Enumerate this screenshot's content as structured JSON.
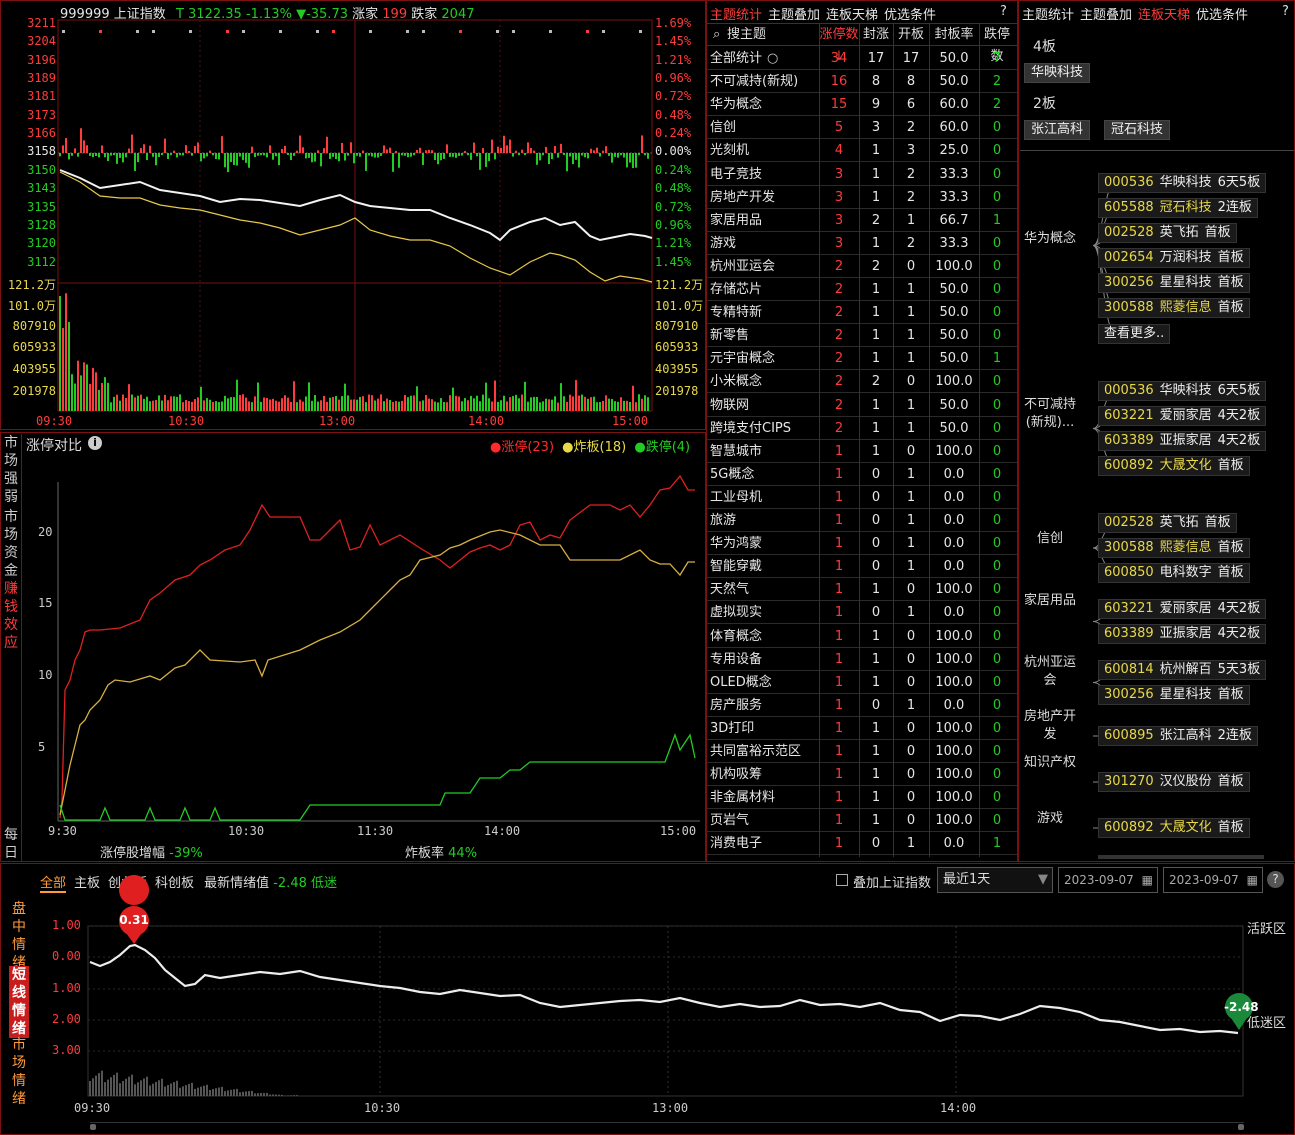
{
  "index_chart": {
    "code": "999999",
    "name": "上证指数",
    "t_label": "T",
    "price": "3122.35",
    "pct": "-1.13%",
    "change": "▼-35.73",
    "rise_label": "涨家",
    "rise_count": "199",
    "fall_label": "跌家",
    "fall_count": "2047",
    "price_ticks": [
      "3211",
      "3204",
      "3196",
      "3189",
      "3181",
      "3173",
      "3166",
      "3158",
      "3150",
      "3143",
      "3135",
      "3128",
      "3120",
      "3112"
    ],
    "pct_ticks": [
      "1.69%",
      "1.45%",
      "1.21%",
      "0.96%",
      "0.72%",
      "0.48%",
      "0.24%",
      "0.00%",
      "0.24%",
      "0.48%",
      "0.72%",
      "0.96%",
      "1.21%",
      "1.45%"
    ],
    "vol_ticks_left": [
      "121.2万",
      "101.0万",
      "807910",
      "605933",
      "403955",
      "201978"
    ],
    "vol_ticks_right": [
      "121.2万",
      "101.0万",
      "807910",
      "605933",
      "403955",
      "201978"
    ],
    "time_ticks": [
      "09:30",
      "10:30",
      "13:00",
      "14:00",
      "15:00"
    ]
  },
  "limit_compare": {
    "side_tabs": [
      "市场强弱",
      "市场资金",
      "赚钱效应",
      "每日"
    ],
    "title": "涨停对比",
    "info_icon": "info-icon",
    "legend": [
      {
        "label": "涨停(23)",
        "color": "#ff2a2a"
      },
      {
        "label": "炸板(18)",
        "color": "#e8d84a"
      },
      {
        "label": "跌停(4)",
        "color": "#22cc22"
      }
    ],
    "y_ticks": [
      "20",
      "15",
      "10",
      "5"
    ],
    "x_ticks": [
      "9:30",
      "10:30",
      "11:30",
      "14:00",
      "15:00"
    ],
    "footer_left_label": "涨停股增幅",
    "footer_left_value": "-39%",
    "footer_right_label": "炸板率",
    "footer_right_value": "44%"
  },
  "theme_stats": {
    "tabs": [
      "主题统计",
      "主题叠加",
      "连板天梯",
      "优选条件"
    ],
    "active_tab": 0,
    "help": "?",
    "headers": [
      "搜主题",
      "涨停数↓",
      "封涨",
      "开板",
      "封板率",
      "跌停数"
    ],
    "search_icon": "search-icon",
    "rows": [
      [
        "全部统计",
        "34",
        "17",
        "17",
        "50.0",
        "7"
      ],
      [
        "不可减持(新规)",
        "16",
        "8",
        "8",
        "50.0",
        "2"
      ],
      [
        "华为概念",
        "15",
        "9",
        "6",
        "60.0",
        "2"
      ],
      [
        "信创",
        "5",
        "3",
        "2",
        "60.0",
        "0"
      ],
      [
        "光刻机",
        "4",
        "1",
        "3",
        "25.0",
        "0"
      ],
      [
        "电子竞技",
        "3",
        "1",
        "2",
        "33.3",
        "0"
      ],
      [
        "房地产开发",
        "3",
        "1",
        "2",
        "33.3",
        "0"
      ],
      [
        "家居用品",
        "3",
        "2",
        "1",
        "66.7",
        "1"
      ],
      [
        "游戏",
        "3",
        "1",
        "2",
        "33.3",
        "0"
      ],
      [
        "杭州亚运会",
        "2",
        "2",
        "0",
        "100.0",
        "0"
      ],
      [
        "存储芯片",
        "2",
        "1",
        "1",
        "50.0",
        "0"
      ],
      [
        "专精特新",
        "2",
        "1",
        "1",
        "50.0",
        "0"
      ],
      [
        "新零售",
        "2",
        "1",
        "1",
        "50.0",
        "0"
      ],
      [
        "元宇宙概念",
        "2",
        "1",
        "1",
        "50.0",
        "1"
      ],
      [
        "小米概念",
        "2",
        "2",
        "0",
        "100.0",
        "0"
      ],
      [
        "物联网",
        "2",
        "1",
        "1",
        "50.0",
        "0"
      ],
      [
        "跨境支付CIPS",
        "2",
        "1",
        "1",
        "50.0",
        "0"
      ],
      [
        "智慧城市",
        "1",
        "1",
        "0",
        "100.0",
        "0"
      ],
      [
        "5G概念",
        "1",
        "0",
        "1",
        "0.0",
        "0"
      ],
      [
        "工业母机",
        "1",
        "0",
        "1",
        "0.0",
        "0"
      ],
      [
        "旅游",
        "1",
        "0",
        "1",
        "0.0",
        "0"
      ],
      [
        "华为鸿蒙",
        "1",
        "0",
        "1",
        "0.0",
        "0"
      ],
      [
        "智能穿戴",
        "1",
        "0",
        "1",
        "0.0",
        "0"
      ],
      [
        "天然气",
        "1",
        "1",
        "0",
        "100.0",
        "0"
      ],
      [
        "虚拟现实",
        "1",
        "0",
        "1",
        "0.0",
        "0"
      ],
      [
        "体育概念",
        "1",
        "1",
        "0",
        "100.0",
        "0"
      ],
      [
        "专用设备",
        "1",
        "1",
        "0",
        "100.0",
        "0"
      ],
      [
        "OLED概念",
        "1",
        "1",
        "0",
        "100.0",
        "0"
      ],
      [
        "房产服务",
        "1",
        "0",
        "1",
        "0.0",
        "0"
      ],
      [
        "3D打印",
        "1",
        "1",
        "0",
        "100.0",
        "0"
      ],
      [
        "共同富裕示范区",
        "1",
        "1",
        "0",
        "100.0",
        "0"
      ],
      [
        "机构吸筹",
        "1",
        "1",
        "0",
        "100.0",
        "0"
      ],
      [
        "非金属材料",
        "1",
        "1",
        "0",
        "100.0",
        "0"
      ],
      [
        "页岩气",
        "1",
        "1",
        "0",
        "100.0",
        "0"
      ],
      [
        "消费电子",
        "1",
        "0",
        "1",
        "0.0",
        "1"
      ]
    ]
  },
  "ladder": {
    "tabs": [
      "主题统计",
      "主题叠加",
      "连板天梯",
      "优选条件"
    ],
    "active_tab": 2,
    "help": "?",
    "levels": [
      {
        "label": "4板",
        "stocks": [
          "华映科技"
        ]
      },
      {
        "label": "2板",
        "stocks": [
          "张江高科",
          "冠石科技"
        ]
      }
    ],
    "groups": [
      {
        "name": "华为概念",
        "items": [
          [
            "000536",
            "华映科技",
            "6天5板"
          ],
          [
            "605588",
            "冠石科技",
            "2连板"
          ],
          [
            "002528",
            "英飞拓",
            "首板"
          ],
          [
            "002654",
            "万润科技",
            "首板"
          ],
          [
            "300256",
            "星星科技",
            "首板"
          ],
          [
            "300588",
            "熙菱信息",
            "首板"
          ]
        ],
        "more": "查看更多.."
      },
      {
        "name": "不可减持(新规)...",
        "items": [
          [
            "000536",
            "华映科技",
            "6天5板"
          ],
          [
            "603221",
            "爱丽家居",
            "4天2板"
          ],
          [
            "603389",
            "亚振家居",
            "4天2板"
          ],
          [
            "600892",
            "大晟文化",
            "首板"
          ]
        ]
      },
      {
        "name": "信创",
        "items": [
          [
            "002528",
            "英飞拓",
            "首板"
          ],
          [
            "300588",
            "熙菱信息",
            "首板"
          ],
          [
            "600850",
            "电科数字",
            "首板"
          ]
        ]
      },
      {
        "name": "家居用品",
        "items": [
          [
            "603221",
            "爱丽家居",
            "4天2板"
          ],
          [
            "603389",
            "亚振家居",
            "4天2板"
          ]
        ]
      },
      {
        "name": "杭州亚运会",
        "items": [
          [
            "600814",
            "杭州解百",
            "5天3板"
          ],
          [
            "300256",
            "星星科技",
            "首板"
          ]
        ]
      },
      {
        "name": "房地产开发",
        "items": [
          [
            "600895",
            "张江高科",
            "2连板"
          ]
        ]
      },
      {
        "name": "知识产权",
        "items": [
          [
            "301270",
            "汉仪股份",
            "首板"
          ]
        ]
      },
      {
        "name": "游戏",
        "items": [
          [
            "600892",
            "大晟文化",
            "首板"
          ]
        ]
      }
    ]
  },
  "sentiment": {
    "side_tabs": [
      "盘中情绪",
      "短线情绪",
      "市场情绪"
    ],
    "active_side": 1,
    "filters": [
      "全部",
      "主板",
      "创业板",
      "科创板"
    ],
    "active_filter": 0,
    "latest_label": "最新情绪值",
    "latest_value": "-2.48",
    "latest_state": "低迷",
    "overlay_label": "叠加上证指数",
    "range_select": "最近1天",
    "date_from": "2023-09-07",
    "date_to": "2023-09-07",
    "help": "?",
    "y_ticks": [
      "1.00",
      "0.00",
      "1.00",
      "2.00",
      "3.00"
    ],
    "x_ticks": [
      "09:30",
      "10:30",
      "13:00",
      "14:00"
    ],
    "zone_top": "活跃区",
    "zone_bottom": "低迷区",
    "peak_marker": "0.31",
    "end_marker": "-2.48"
  }
}
